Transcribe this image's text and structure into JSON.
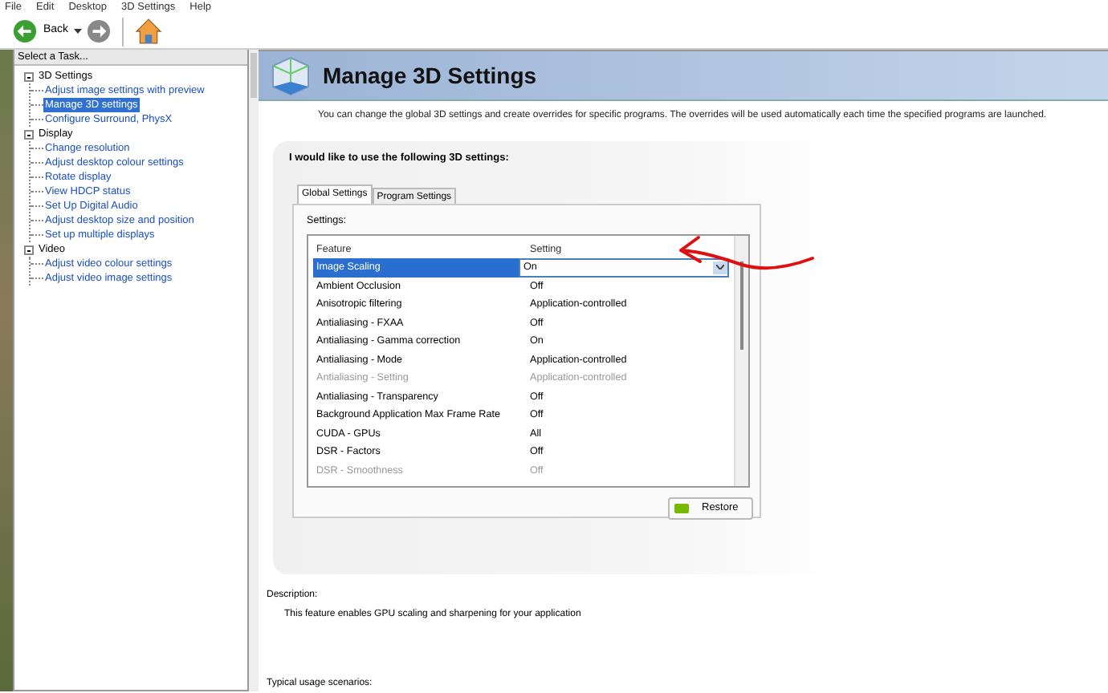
{
  "menu": [
    "File",
    "Edit",
    "Desktop",
    "3D Settings",
    "Help"
  ],
  "toolbar": {
    "back": "Back"
  },
  "sidebar": {
    "title": "Select a Task...",
    "tree": [
      {
        "label": "3D Settings",
        "expanded": true,
        "children": [
          {
            "label": "Adjust image settings with preview",
            "selected": false
          },
          {
            "label": "Manage 3D settings",
            "selected": true
          },
          {
            "label": "Configure Surround, PhysX",
            "selected": false
          }
        ]
      },
      {
        "label": "Display",
        "expanded": true,
        "children": [
          {
            "label": "Change resolution",
            "selected": false
          },
          {
            "label": "Adjust desktop colour settings",
            "selected": false
          },
          {
            "label": "Rotate display",
            "selected": false
          },
          {
            "label": "View HDCP status",
            "selected": false
          },
          {
            "label": "Set Up Digital Audio",
            "selected": false
          },
          {
            "label": "Adjust desktop size and position",
            "selected": false
          },
          {
            "label": "Set up multiple displays",
            "selected": false
          }
        ]
      },
      {
        "label": "Video",
        "expanded": true,
        "children": [
          {
            "label": "Adjust video colour settings",
            "selected": false
          },
          {
            "label": "Adjust video image settings",
            "selected": false
          }
        ]
      }
    ]
  },
  "page": {
    "title": "Manage 3D Settings",
    "intro": "You can change the global 3D settings and create overrides for specific programs. The overrides will be used automatically each time the specified programs are launched.",
    "heading": "I would like to use the following 3D settings:",
    "tabs": [
      {
        "label": "Global Settings",
        "selected": true
      },
      {
        "label": "Program Settings",
        "selected": false
      }
    ],
    "settings_label": "Settings:",
    "table": {
      "columns": [
        "Feature",
        "Setting"
      ],
      "rows": [
        {
          "feature": "Image Scaling",
          "setting": "On",
          "selected": true,
          "disabled": false
        },
        {
          "feature": "Ambient Occlusion",
          "setting": "Off",
          "selected": false,
          "disabled": false
        },
        {
          "feature": "Anisotropic filtering",
          "setting": "Application-controlled",
          "selected": false,
          "disabled": false
        },
        {
          "feature": "Antialiasing - FXAA",
          "setting": "Off",
          "selected": false,
          "disabled": false
        },
        {
          "feature": "Antialiasing - Gamma correction",
          "setting": "On",
          "selected": false,
          "disabled": false
        },
        {
          "feature": "Antialiasing - Mode",
          "setting": "Application-controlled",
          "selected": false,
          "disabled": false
        },
        {
          "feature": "Antialiasing - Setting",
          "setting": "Application-controlled",
          "selected": false,
          "disabled": true
        },
        {
          "feature": "Antialiasing - Transparency",
          "setting": "Off",
          "selected": false,
          "disabled": false
        },
        {
          "feature": "Background Application Max Frame Rate",
          "setting": "Off",
          "selected": false,
          "disabled": false
        },
        {
          "feature": "CUDA - GPUs",
          "setting": "All",
          "selected": false,
          "disabled": false
        },
        {
          "feature": "DSR - Factors",
          "setting": "Off",
          "selected": false,
          "disabled": false
        },
        {
          "feature": "DSR - Smoothness",
          "setting": "Off",
          "selected": false,
          "disabled": true
        }
      ]
    },
    "restore": "Restore",
    "description_label": "Description:",
    "description": "This feature enables GPU scaling and sharpening for your application",
    "usage_label": "Typical usage scenarios:"
  }
}
